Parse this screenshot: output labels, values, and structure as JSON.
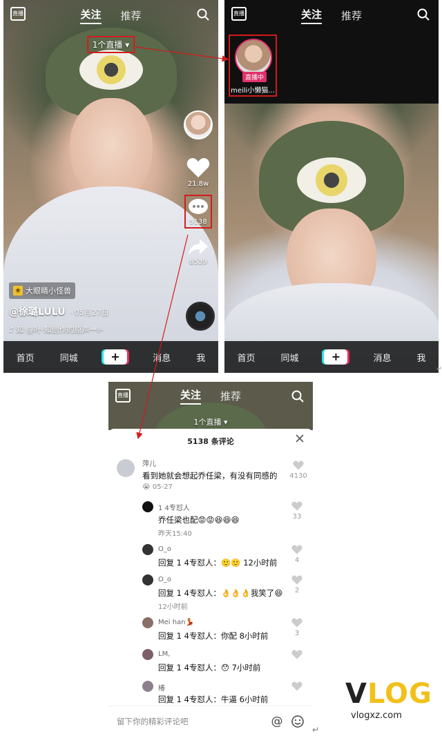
{
  "screen1": {
    "topbar": {
      "live_icon": "直播",
      "tab_follow": "关注",
      "tab_recommend": "推荐"
    },
    "live_count": "1个直播 ▾",
    "actions": {
      "likes": "21.8w",
      "comments": "5138",
      "shares": "8539"
    },
    "tag": "大眼睛小怪兽",
    "author": "@徐璐LULU",
    "date": "· 05月27日",
    "music": "♪ 知    @叶·知创作的原声一⊩",
    "nav": {
      "home": "首页",
      "city": "同城",
      "plus": "+",
      "messages": "消息",
      "me": "我"
    }
  },
  "screen2": {
    "topbar": {
      "live_icon": "直播",
      "tab_follow": "关注",
      "tab_recommend": "推荐"
    },
    "live_badge": "直播中",
    "live_name": "meili小懒猫...",
    "nav": {
      "home": "首页",
      "city": "同城",
      "plus": "+",
      "messages": "消息",
      "me": "我"
    }
  },
  "screen3": {
    "topbar": {
      "live_icon": "直播",
      "tab_follow": "关注",
      "tab_recommend": "推荐"
    },
    "live_count": "1个直播 ▾",
    "panel_title": "5138 条评论",
    "comments": [
      {
        "user": "萍儿",
        "text": "看到她就会想起乔任梁，有没有同感的",
        "time": "😭 05-27",
        "likes": "4130"
      },
      {
        "user": "1  4专怼人",
        "text": "乔任梁也配😡😡😆😆😆",
        "time": "昨天15:40",
        "likes": "33"
      },
      {
        "user": "O_o",
        "text": "回复 1  4专怼人：🙂🙂 12小时前",
        "time": "",
        "likes": "4"
      },
      {
        "user": "O_o",
        "text": "回复 1  4专怼人：👌👌👌我笑了😆",
        "time": "12小时前",
        "likes": "2"
      },
      {
        "user": "Mei han💃",
        "text": "回复 1  4专怼人：你配 8小时前",
        "time": "",
        "likes": "3"
      },
      {
        "user": "LM,",
        "text": "回复 1  4专怼人：😯 7小时前",
        "time": "",
        "likes": ""
      },
      {
        "user": "椿",
        "text": "回复 1  4专怼人：牛逼 6小时前",
        "time": "",
        "likes": ""
      }
    ],
    "input_placeholder": "留下你的精彩评论吧",
    "at_symbol": "@",
    "emoji_icon": "smile-icon"
  },
  "watermark": {
    "logo_v": "V",
    "logo_log": "LOG",
    "url": "vlogxz.com"
  },
  "colors": {
    "highlight_red": "#d21c1c",
    "live_pink": "#e0306a",
    "brand_yellow": "#f2c01a"
  }
}
